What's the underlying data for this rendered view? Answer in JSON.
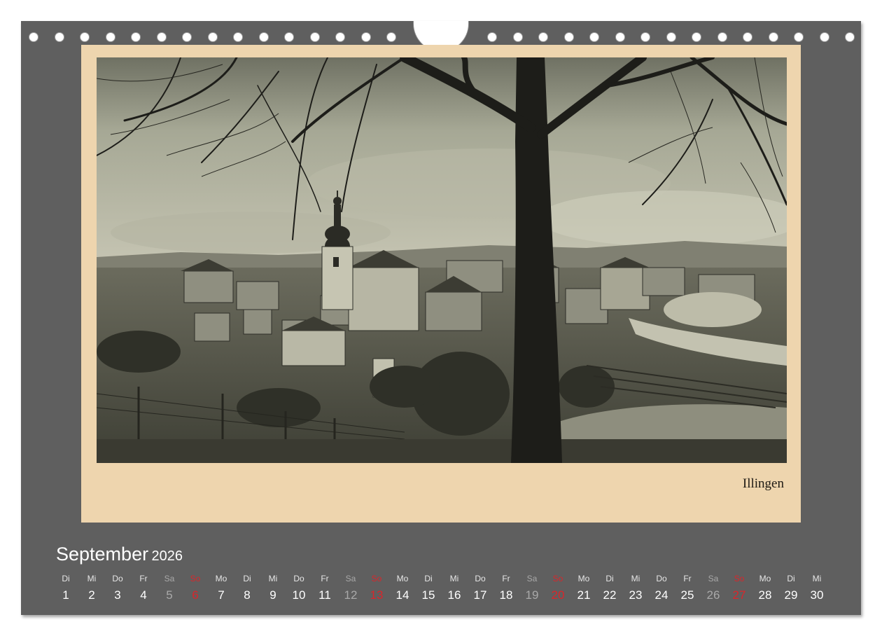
{
  "photo": {
    "caption": "Illingen"
  },
  "calendar": {
    "month": "September",
    "year": "2026",
    "days": [
      {
        "weekday": "Di",
        "day": "1",
        "type": "weekday"
      },
      {
        "weekday": "Mi",
        "day": "2",
        "type": "weekday"
      },
      {
        "weekday": "Do",
        "day": "3",
        "type": "weekday"
      },
      {
        "weekday": "Fr",
        "day": "4",
        "type": "weekday"
      },
      {
        "weekday": "Sa",
        "day": "5",
        "type": "saturday"
      },
      {
        "weekday": "So",
        "day": "6",
        "type": "sunday"
      },
      {
        "weekday": "Mo",
        "day": "7",
        "type": "weekday"
      },
      {
        "weekday": "Di",
        "day": "8",
        "type": "weekday"
      },
      {
        "weekday": "Mi",
        "day": "9",
        "type": "weekday"
      },
      {
        "weekday": "Do",
        "day": "10",
        "type": "weekday"
      },
      {
        "weekday": "Fr",
        "day": "11",
        "type": "weekday"
      },
      {
        "weekday": "Sa",
        "day": "12",
        "type": "saturday"
      },
      {
        "weekday": "So",
        "day": "13",
        "type": "sunday"
      },
      {
        "weekday": "Mo",
        "day": "14",
        "type": "weekday"
      },
      {
        "weekday": "Di",
        "day": "15",
        "type": "weekday"
      },
      {
        "weekday": "Mi",
        "day": "16",
        "type": "weekday"
      },
      {
        "weekday": "Do",
        "day": "17",
        "type": "weekday"
      },
      {
        "weekday": "Fr",
        "day": "18",
        "type": "weekday"
      },
      {
        "weekday": "Sa",
        "day": "19",
        "type": "saturday"
      },
      {
        "weekday": "So",
        "day": "20",
        "type": "sunday"
      },
      {
        "weekday": "Mo",
        "day": "21",
        "type": "weekday"
      },
      {
        "weekday": "Di",
        "day": "22",
        "type": "weekday"
      },
      {
        "weekday": "Mi",
        "day": "23",
        "type": "weekday"
      },
      {
        "weekday": "Do",
        "day": "24",
        "type": "weekday"
      },
      {
        "weekday": "Fr",
        "day": "25",
        "type": "weekday"
      },
      {
        "weekday": "Sa",
        "day": "26",
        "type": "saturday"
      },
      {
        "weekday": "So",
        "day": "27",
        "type": "sunday"
      },
      {
        "weekday": "Mo",
        "day": "28",
        "type": "weekday"
      },
      {
        "weekday": "Di",
        "day": "29",
        "type": "weekday"
      },
      {
        "weekday": "Mi",
        "day": "30",
        "type": "weekday"
      }
    ]
  },
  "colors": {
    "background": "#5f5f5f",
    "mat": "#eed5ae",
    "sunday": "#d9262b",
    "saturday": "#a9a9a9"
  }
}
